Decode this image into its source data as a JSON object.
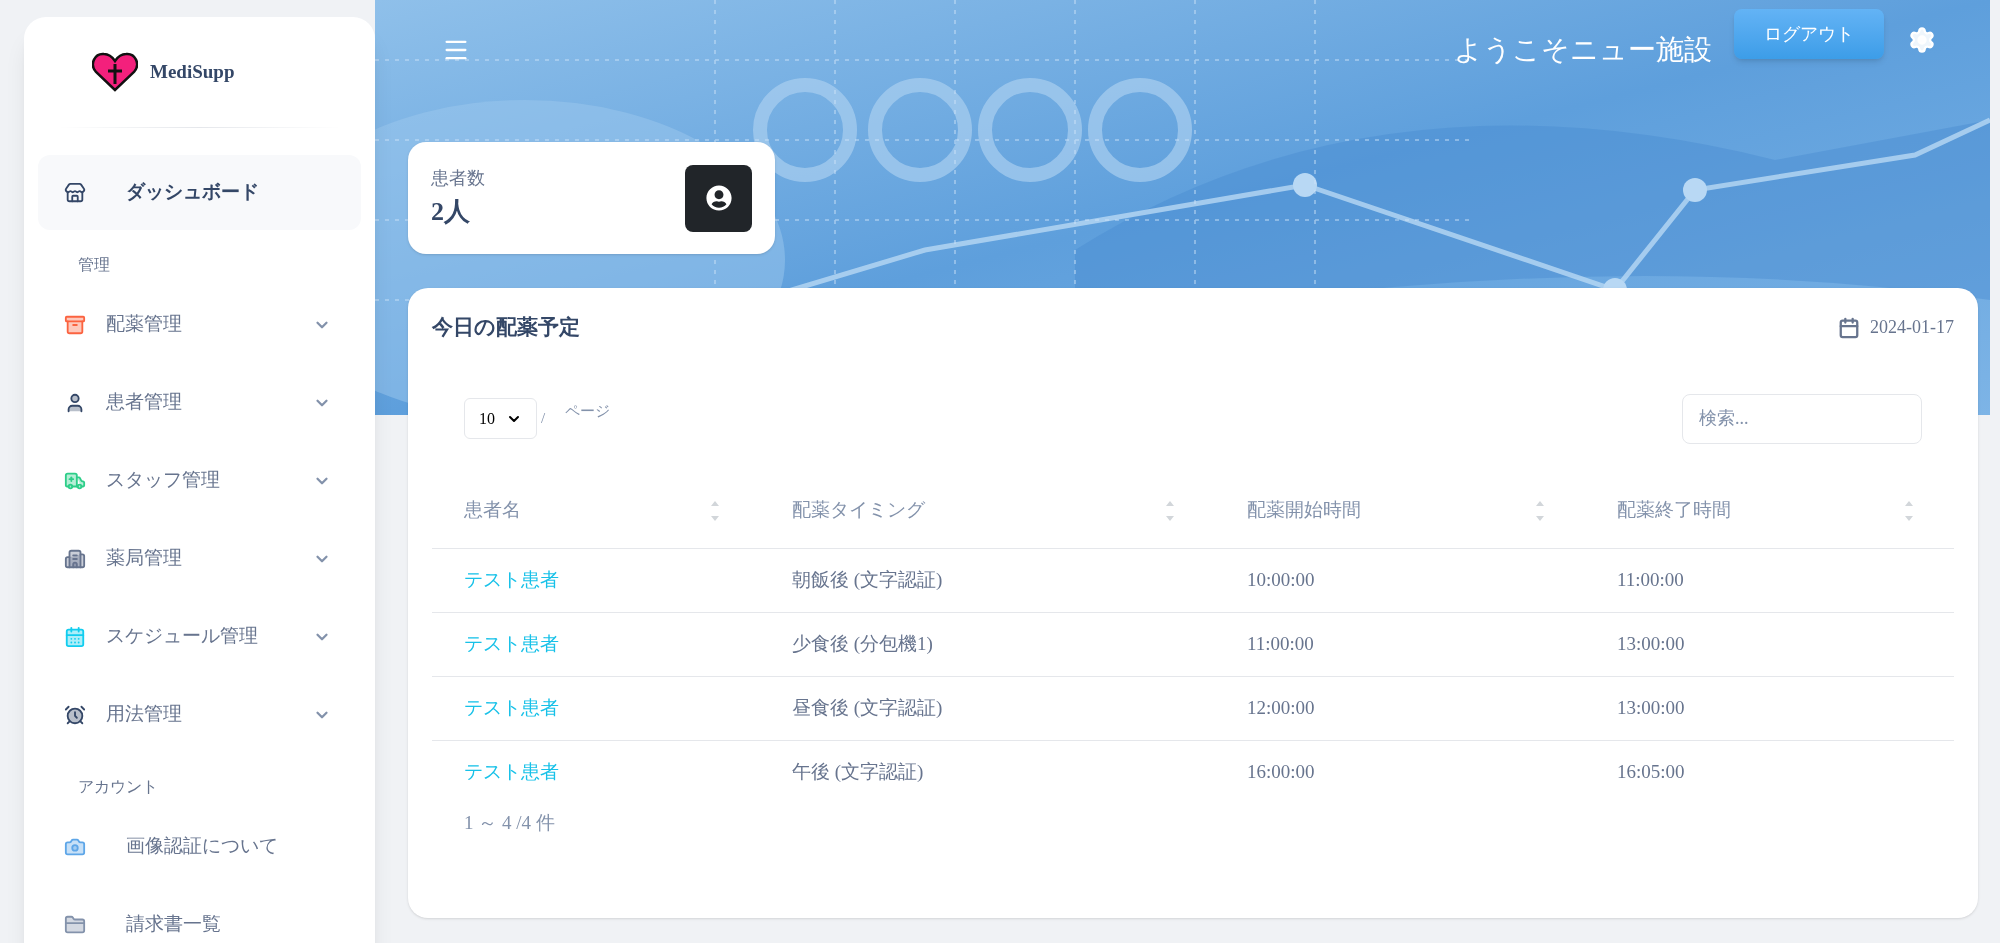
{
  "sidebar": {
    "brand": "MediSupp",
    "sections": [
      {
        "items": [
          {
            "label": "ダッシュボード",
            "selected": true,
            "color": "#344767"
          }
        ]
      },
      {
        "heading": "管理",
        "items": [
          {
            "label": "配薬管理",
            "selected": false,
            "expanded": false,
            "color": "#fb6340"
          },
          {
            "label": "患者管理",
            "selected": false,
            "expanded": false,
            "color": "#344767"
          },
          {
            "label": "スタッフ管理",
            "selected": false,
            "expanded": false,
            "color": "#2dce89"
          },
          {
            "label": "薬局管理",
            "selected": false,
            "expanded": false,
            "color": "#67748e"
          },
          {
            "label": "スケジュール管理",
            "selected": false,
            "expanded": false,
            "color": "#11cdef"
          },
          {
            "label": "用法管理",
            "selected": false,
            "expanded": false,
            "color": "#344767"
          }
        ]
      },
      {
        "heading": "アカウント",
        "items": [
          {
            "label": "画像認証について",
            "selected": false,
            "color": "#5ea6e8"
          },
          {
            "label": "請求書一覧",
            "selected": false,
            "color": "#8392ab"
          }
        ]
      }
    ]
  },
  "header": {
    "welcome": "ようこそニュー施設",
    "logout": "ログアウト"
  },
  "stat_card": {
    "label": "患者数",
    "value": "2人"
  },
  "schedule": {
    "title": "今日の配薬予定",
    "date": "2024-01-17",
    "page_size": "10",
    "page_separator": "/",
    "page_label": "ページ",
    "search": {
      "placeholder": "検索..."
    },
    "columns": [
      "患者名",
      "配薬タイミング",
      "配薬開始時間",
      "配薬終了時間"
    ],
    "rows": [
      [
        "テスト患者",
        "朝飯後 (文字認証)",
        "10:00:00",
        "11:00:00"
      ],
      [
        "テスト患者",
        "少食後 (分包機1)",
        "11:00:00",
        "13:00:00"
      ],
      [
        "テスト患者",
        "昼食後 (文字認証)",
        "12:00:00",
        "13:00:00"
      ],
      [
        "テスト患者",
        "午後 (文字認証)",
        "16:00:00",
        "16:05:00"
      ]
    ],
    "footer": "1 ～ 4 /4 件"
  }
}
